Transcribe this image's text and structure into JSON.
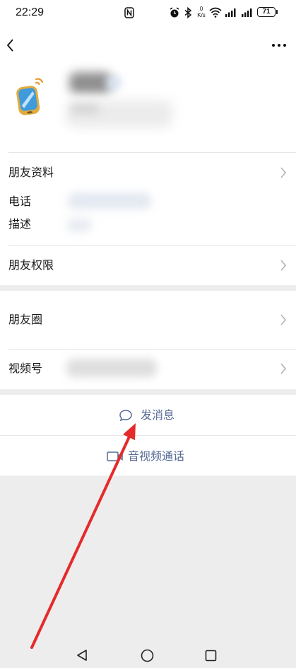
{
  "status_bar": {
    "time": "22:29",
    "net_speed_value": "0",
    "net_speed_unit": "K/s",
    "battery": "71",
    "icons": [
      "nfc-icon",
      "alarm-icon",
      "bluetooth-icon",
      "wifi-icon",
      "signal-icon",
      "signal-icon",
      "battery-icon"
    ]
  },
  "header": {
    "back_icon": "chevron-left-icon",
    "more_icon": "more-icon"
  },
  "profile": {
    "avatar_icon": "tablet-wifi-avatar-icon"
  },
  "info": {
    "friend_profile": "朋友资料",
    "phone": "电话",
    "description": "描述",
    "friend_permissions": "朋友权限"
  },
  "social": {
    "moments": "朋友圈",
    "channels": "视频号"
  },
  "actions": {
    "send_message": "发消息",
    "send_message_icon": "chat-bubble-icon",
    "av_call": "音视频通话",
    "av_call_icon": "video-camera-icon"
  },
  "nav_bar": {
    "icons": [
      "back-triangle-icon",
      "home-circle-icon",
      "recents-square-icon"
    ]
  },
  "colors": {
    "accent": "#576b95",
    "text": "#191919",
    "chevron": "#b2b2b2",
    "divider": "#e6e6e6",
    "background": "#ededed",
    "annotation_arrow": "#e52a2a"
  }
}
